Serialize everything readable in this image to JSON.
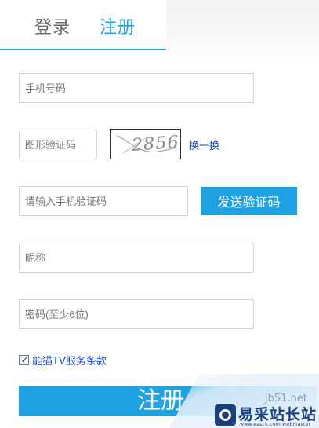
{
  "tabs": {
    "login_label": "登录",
    "register_label": "注册"
  },
  "form": {
    "phone_placeholder": "手机号码",
    "captcha_placeholder": "图形验证码",
    "captcha_image_text": "2856",
    "captcha_refresh_label": "换一换",
    "sms_code_placeholder": "请输入手机验证码",
    "send_code_label": "发送验证码",
    "nickname_placeholder": "昵称",
    "password_placeholder": "密码(至少6位)",
    "terms_checked": true,
    "terms_label": "能猫TV服务条款",
    "submit_label": "注册"
  },
  "watermark": {
    "url": "jb51.net",
    "brand": "易采站长站",
    "tagline": "www.easck.com webmaster"
  },
  "colors": {
    "accent": "#1fa2e4",
    "link": "#1c4fbf",
    "inactive_tab": "#6a6a6a"
  }
}
